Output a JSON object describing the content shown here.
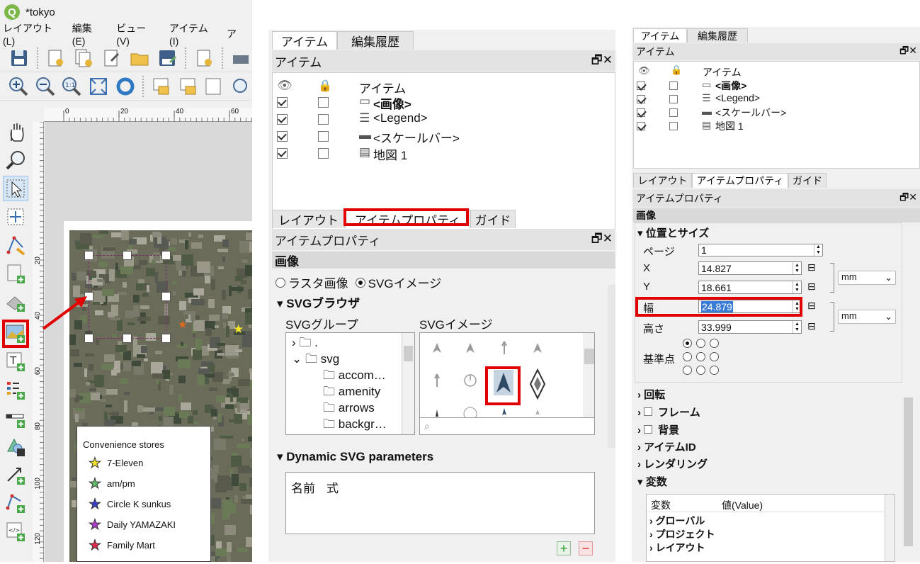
{
  "window": {
    "title": "*tokyo",
    "menu": [
      "レイアウト(L)",
      "編集(E)",
      "ビュー(V)",
      "アイテム(I)",
      "ア"
    ]
  },
  "ruler": {
    "h_ticks": [
      "0",
      "20",
      "40",
      "60"
    ],
    "v_ticks": [
      "20",
      "40",
      "60",
      "80",
      "100",
      "120"
    ]
  },
  "legend": {
    "title": "Convenience stores",
    "items": [
      {
        "label": "7-Eleven",
        "color": "#f5e52a"
      },
      {
        "label": "am/pm",
        "color": "#5fbf6a"
      },
      {
        "label": "Circle K sunkus",
        "color": "#3a3fc8"
      },
      {
        "label": "Daily YAMAZAKI",
        "color": "#b040d0"
      },
      {
        "label": "Family Mart",
        "color": "#e0284a"
      }
    ]
  },
  "mid": {
    "tabs_top": [
      "アイテム",
      "編集履歴"
    ],
    "items_header": "アイテム",
    "col_item": "アイテム",
    "items": [
      "<画像>",
      "<Legend>",
      "<スケールバー>",
      "地図 1"
    ],
    "tabs_bottom": [
      "レイアウト",
      "アイテムプロパティ",
      "ガイド"
    ],
    "props_header": "アイテムプロパティ",
    "section": "画像",
    "radio_raster": "ラスタ画像",
    "radio_svg": "SVGイメージ",
    "svg_browser": "SVGブラウザ",
    "svg_group": "SVGグループ",
    "svg_image": "SVGイメージ",
    "groups": [
      ".",
      "svg",
      "accom…",
      "amenity",
      "arrows",
      "backgr…"
    ],
    "dynamic": "Dynamic SVG parameters",
    "col_name": "名前",
    "col_expr": "式"
  },
  "right": {
    "tabs_top": [
      "アイテム",
      "編集履歴"
    ],
    "items_header": "アイテム",
    "col_item": "アイテム",
    "items": [
      "<画像>",
      "<Legend>",
      "<スケールバー>",
      "地図 1"
    ],
    "tabs_bottom": [
      "レイアウト",
      "アイテムプロパティ",
      "ガイド"
    ],
    "props_header": "アイテムプロパティ",
    "section": "画像",
    "pos_size": "位置とサイズ",
    "page_label": "ページ",
    "page_value": "1",
    "x_label": "X",
    "x_value": "14.827",
    "y_label": "Y",
    "y_value": "18.661",
    "w_label": "幅",
    "w_value": "24.879",
    "h_label": "高さ",
    "h_value": "33.999",
    "unit": "mm",
    "ref_label": "基準点",
    "sections": [
      "回転",
      "フレーム",
      "背景",
      "アイテムID",
      "レンダリング",
      "変数"
    ],
    "var_col1": "変数",
    "var_col2": "値(Value)",
    "vars": [
      "グローバル",
      "プロジェクト",
      "レイアウト"
    ]
  }
}
